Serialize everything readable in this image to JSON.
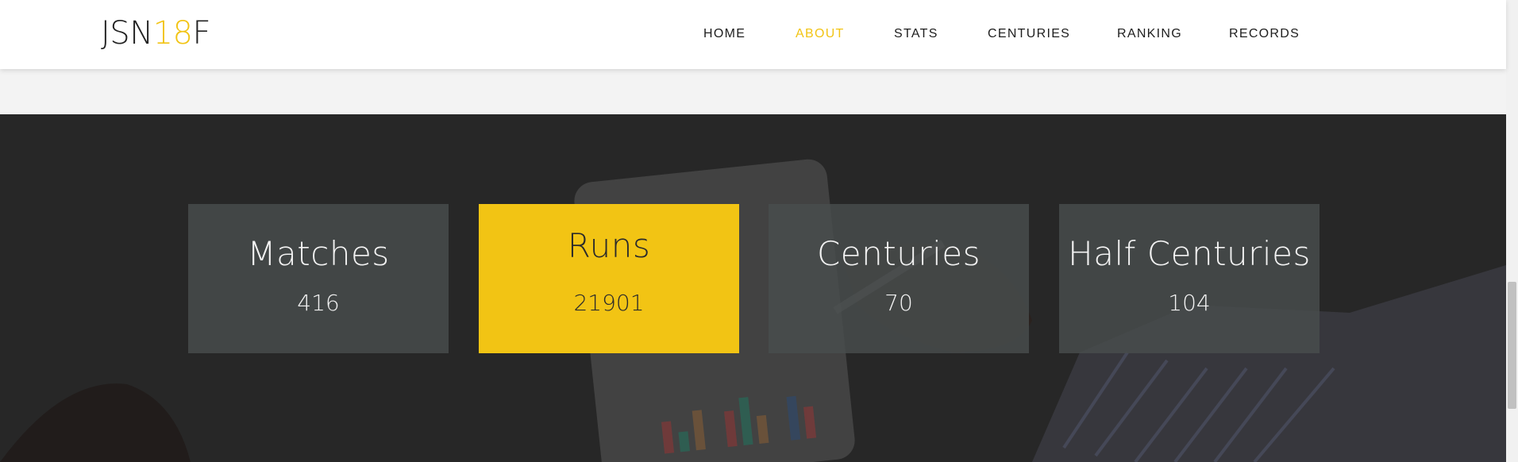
{
  "brand": {
    "logo_prefix": "JSN",
    "logo_accent": "18",
    "logo_suffix": "F"
  },
  "nav": {
    "items": [
      {
        "label": "HOME",
        "active": false
      },
      {
        "label": "ABOUT",
        "active": true
      },
      {
        "label": "STATS",
        "active": false
      },
      {
        "label": "CENTURIES",
        "active": false
      },
      {
        "label": "RANKING",
        "active": false
      },
      {
        "label": "RECORDS",
        "active": false
      }
    ]
  },
  "stats": [
    {
      "title": "Matches",
      "value": "416",
      "active": false
    },
    {
      "title": "Runs",
      "value": "21901",
      "active": true
    },
    {
      "title": "Centuries",
      "value": "70",
      "active": false
    },
    {
      "title": "Half Centuries",
      "value": "104",
      "active": false
    }
  ],
  "colors": {
    "accent": "#f2c414",
    "nav_text": "#1e1e1e",
    "card_bg": "#484c4c",
    "hero_bg": "#333333"
  }
}
